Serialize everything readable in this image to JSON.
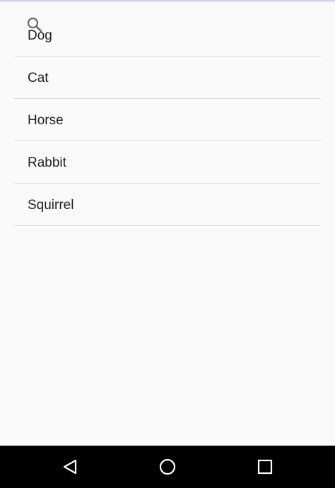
{
  "list": {
    "items": [
      {
        "label": "Dog"
      },
      {
        "label": "Cat"
      },
      {
        "label": "Horse"
      },
      {
        "label": "Rabbit"
      },
      {
        "label": "Squirrel"
      }
    ]
  },
  "icons": {
    "search": "search-icon",
    "back": "back-triangle-icon",
    "home": "home-circle-icon",
    "recents": "recents-square-icon"
  },
  "colors": {
    "background": "#fafafa",
    "divider": "#dcdcdc",
    "text": "#1f1f1f",
    "nav_bar": "#000000",
    "nav_icon": "#ffffff"
  }
}
